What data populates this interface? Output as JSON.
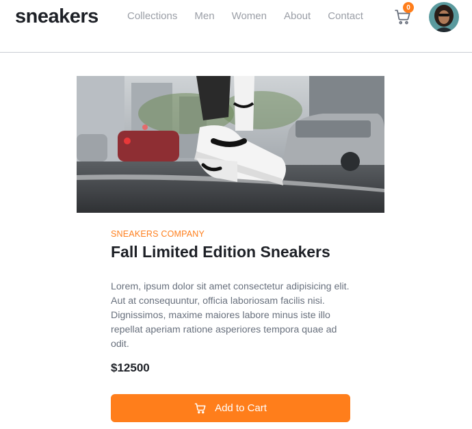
{
  "header": {
    "logo": "sneakers",
    "nav": [
      "Collections",
      "Men",
      "Women",
      "About",
      "Contact"
    ],
    "cart_count": "0",
    "cart_icon": "cart-icon",
    "avatar": "user-avatar"
  },
  "product": {
    "company": "SNEAKERS COMPANY",
    "title": "Fall Limited Edition Sneakers",
    "description": "Lorem, ipsum dolor sit amet consectetur adipisicing elit. Aut at consequuntur, officia laboriosam facilis nisi. Dignissimos, maxime maiores labore minus iste illo repellat aperiam ratione asperiores tempora quae ad odit.",
    "price": "$12500",
    "add_to_cart_label": "Add to Cart"
  },
  "colors": {
    "accent": "#ff7e1b",
    "text_dark": "#1d2026",
    "text_muted": "#68707d",
    "nav_text": "#9a9ea6"
  }
}
